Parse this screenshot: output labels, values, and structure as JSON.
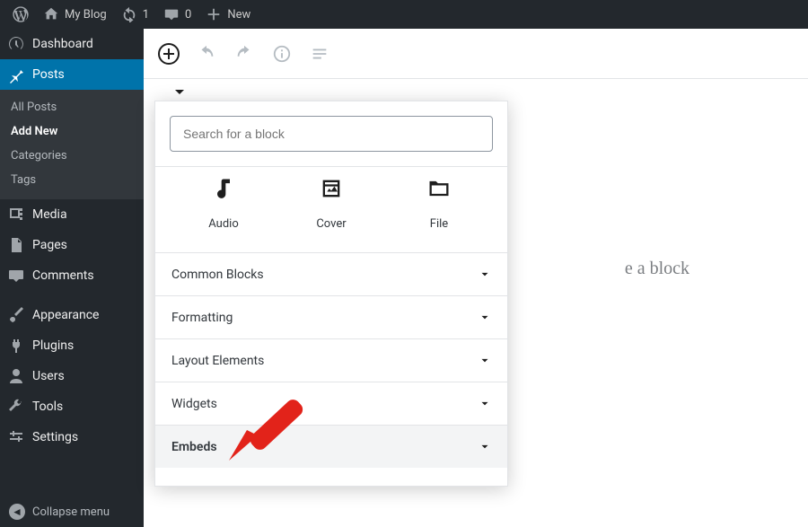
{
  "adminbar": {
    "site_name": "My Blog",
    "updates_count": "1",
    "comments_count": "0",
    "new_label": "New"
  },
  "sidebar": {
    "dashboard": "Dashboard",
    "posts": {
      "label": "Posts",
      "sub": {
        "all": "All Posts",
        "add_new": "Add New",
        "categories": "Categories",
        "tags": "Tags"
      }
    },
    "media": "Media",
    "pages": "Pages",
    "comments": "Comments",
    "appearance": "Appearance",
    "plugins": "Plugins",
    "users": "Users",
    "tools": "Tools",
    "settings": "Settings",
    "collapse": "Collapse menu"
  },
  "editor": {
    "behind_placeholder": "e a block"
  },
  "inserter": {
    "search_placeholder": "Search for a block",
    "blocks": [
      {
        "id": "audio",
        "label": "Audio"
      },
      {
        "id": "cover",
        "label": "Cover"
      },
      {
        "id": "file",
        "label": "File"
      }
    ],
    "categories": [
      {
        "id": "common",
        "label": "Common Blocks"
      },
      {
        "id": "formatting",
        "label": "Formatting"
      },
      {
        "id": "layout",
        "label": "Layout Elements"
      },
      {
        "id": "widgets",
        "label": "Widgets"
      },
      {
        "id": "embeds",
        "label": "Embeds",
        "hovered": true
      }
    ]
  }
}
